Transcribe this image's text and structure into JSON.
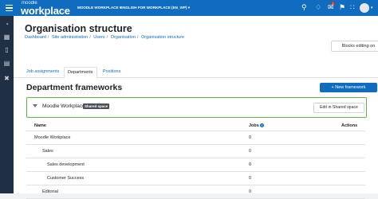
{
  "brand": {
    "small": "moodle",
    "big": "workplace"
  },
  "topmenu": {
    "tenant": "MOODLE WORKPLACE ▾",
    "language": "ENGLISH FOR WORKPLACE (EN_WP) ▾"
  },
  "notifications": {
    "count": "1"
  },
  "header": {
    "title": "Organisation structure",
    "breadcrumb": [
      "Dashboard",
      "Site administration",
      "Users",
      "Organisation",
      "Organisation structure"
    ],
    "blocks_button": "Blocks editing on"
  },
  "tabs": [
    "Job assignments",
    "Departments",
    "Positions"
  ],
  "section": {
    "title": "Department frameworks",
    "new_button": "+ New framework"
  },
  "framework": {
    "name": "Moodle Workplace",
    "badge": "Shared space",
    "edit_button": "Edit in Shared space"
  },
  "table": {
    "headers": {
      "name": "Name",
      "jobs": "Jobs",
      "actions": "Actions"
    },
    "rows": [
      {
        "name": "Moodle Workplace",
        "jobs": "0",
        "level": 0
      },
      {
        "name": "Sales",
        "jobs": "0",
        "level": 1
      },
      {
        "name": "Sales development",
        "jobs": "0",
        "level": 2
      },
      {
        "name": "Customer Success",
        "jobs": "0",
        "level": 2
      },
      {
        "name": "Editorial",
        "jobs": "0",
        "level": 1
      }
    ]
  },
  "colors": {
    "navbar": "#0f6cbf",
    "rail": "#1f3044",
    "highlight": "#69b34c"
  }
}
